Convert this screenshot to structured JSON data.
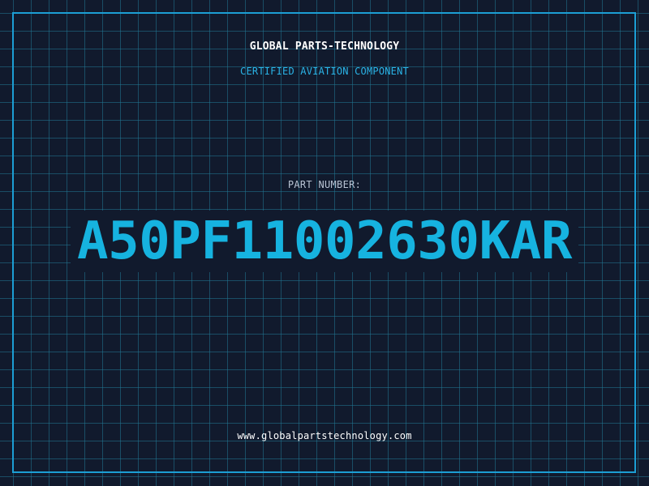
{
  "header": {
    "brand": "GLOBAL PARTS-TECHNOLOGY",
    "subtitle": "CERTIFIED AVIATION COMPONENT"
  },
  "part": {
    "label": "PART NUMBER:",
    "number": "A50PF11002630KAR"
  },
  "footer": {
    "url": "www.globalpartstechnology.com"
  },
  "colors": {
    "background": "#111a2d",
    "grid": "#207694",
    "frame": "#1c9ed4",
    "accent": "#16b3e0",
    "text": "#ffffff",
    "muted": "#b8c3d3"
  }
}
